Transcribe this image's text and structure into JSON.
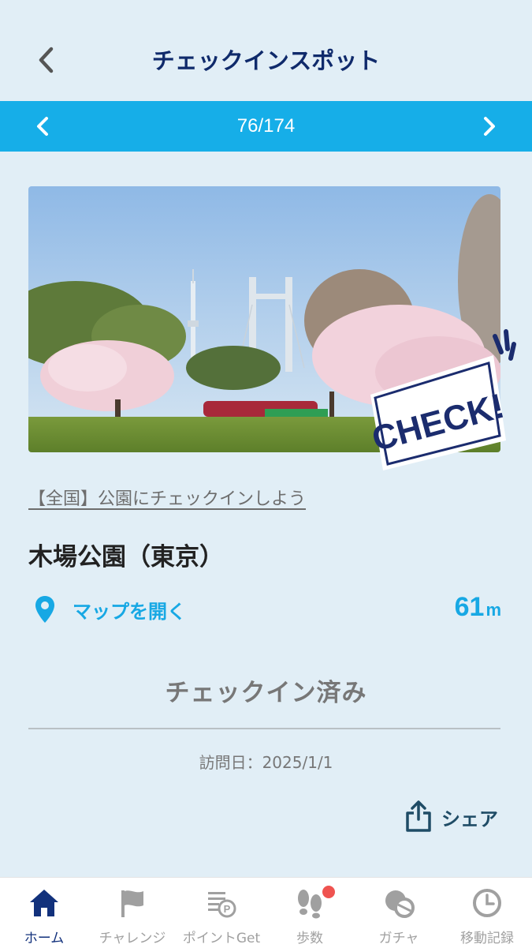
{
  "header": {
    "title": "チェックインスポット"
  },
  "pager": {
    "count": "76/174"
  },
  "photo": {
    "stamp_text": "CHECK!"
  },
  "spot": {
    "category": "【全国】公園にチェックインしよう",
    "name": "木場公園（東京）",
    "map_link": "マップを開く",
    "distance_value": "61",
    "distance_unit": "m",
    "status": "チェックイン済み",
    "visit_date": "訪問日：2025/1/1",
    "share_label": "シェア"
  },
  "tabs": [
    {
      "label": "ホーム",
      "icon": "home-icon",
      "active": true
    },
    {
      "label": "チャレンジ",
      "icon": "flag-icon",
      "active": false
    },
    {
      "label": "ポイントGet",
      "icon": "points-icon",
      "active": false
    },
    {
      "label": "歩数",
      "icon": "footprints-icon",
      "active": false,
      "badge": true
    },
    {
      "label": "ガチャ",
      "icon": "gacha-icon",
      "active": false
    },
    {
      "label": "移動記録",
      "icon": "clock-icon",
      "active": false
    }
  ],
  "colors": {
    "background": "#e1eef6",
    "accent": "#16aee8",
    "title": "#0f2a6b",
    "active_tab": "#12317c",
    "badge": "#ef5350"
  }
}
